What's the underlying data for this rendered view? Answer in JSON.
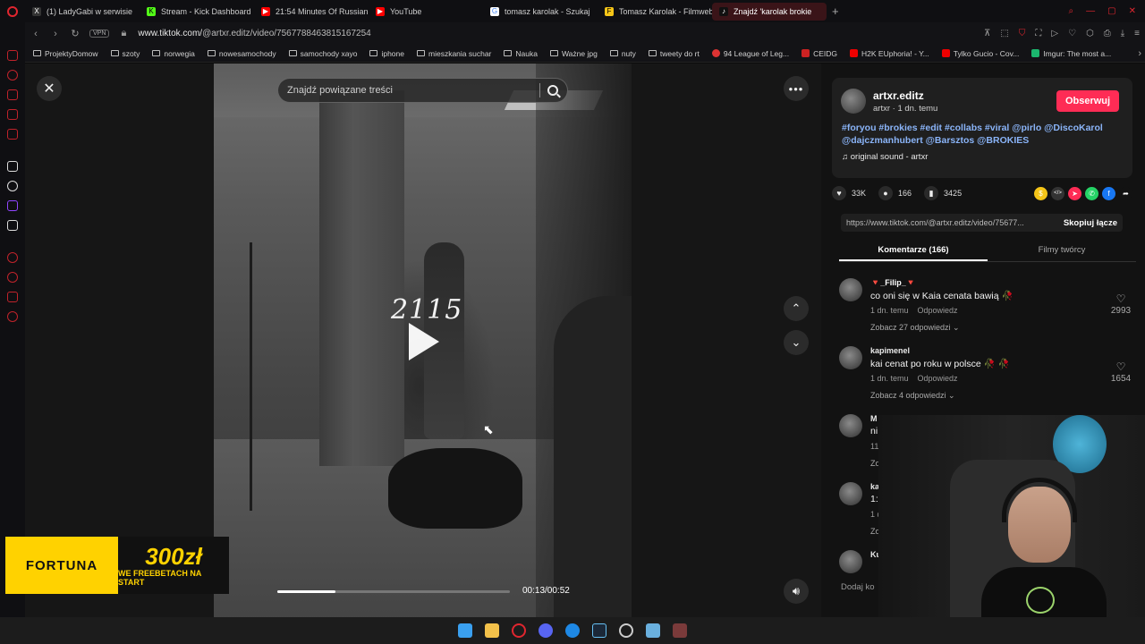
{
  "browser": {
    "tabs": [
      {
        "label": "(1) LadyGabi w serwisie",
        "fav_color": "#333",
        "fav_glyph": "X"
      },
      {
        "label": "Stream - Kick Dashboard",
        "fav_color": "#53fc18",
        "fav_glyph": "K"
      },
      {
        "label": "21:54 Minutes Of Russian",
        "fav_color": "#ff0000",
        "fav_glyph": "▶"
      },
      {
        "label": "YouTube",
        "fav_color": "#ff0000",
        "fav_glyph": "▶"
      },
      {
        "label": "tomasz karolak - Szukaj",
        "fav_color": "#4285f4",
        "fav_glyph": "G"
      },
      {
        "label": "Tomasz Karolak - Filmweb",
        "fav_color": "#f5c518",
        "fav_glyph": "F"
      },
      {
        "label": "Znajdź 'karolak brokie",
        "fav_color": "#111",
        "fav_glyph": "♪"
      }
    ],
    "new_tab": "+",
    "url_prefix": "www.tiktok.com/",
    "url_path": "@artxr.editz/video/7567788463815167254",
    "vpn_label": "VPN",
    "bookmarks": [
      {
        "label": "ProjektyDomow",
        "type": "folder"
      },
      {
        "label": "szoty",
        "type": "folder"
      },
      {
        "label": "norwegia",
        "type": "folder"
      },
      {
        "label": "nowesamochody",
        "type": "folder"
      },
      {
        "label": "samochody xayo",
        "type": "folder"
      },
      {
        "label": "iphone",
        "type": "folder"
      },
      {
        "label": "mieszkania suchar",
        "type": "folder"
      },
      {
        "label": "Nauka",
        "type": "folder"
      },
      {
        "label": "Ważne jpg",
        "type": "folder"
      },
      {
        "label": "nuty",
        "type": "folder"
      },
      {
        "label": "tweety do rt",
        "type": "folder"
      },
      {
        "label": "94 League of Leg...",
        "type": "site",
        "color": "#d33"
      },
      {
        "label": "CEIDG",
        "type": "site",
        "color": "#c22"
      },
      {
        "label": "H2K EUphoria! - Y...",
        "type": "site",
        "color": "#e00"
      },
      {
        "label": "Tylko Gucio - Cov...",
        "type": "site",
        "color": "#e00"
      },
      {
        "label": "Imgur: The most a...",
        "type": "site",
        "color": "#1bb76e"
      }
    ]
  },
  "video": {
    "search_placeholder": "Znajdź powiązane treści",
    "overlay_text": "2115",
    "time": "00:13/00:52",
    "progress": 0.25
  },
  "author": {
    "name": "artxr.editz",
    "sub": "artxr · 1 dn. temu",
    "follow_label": "Obserwuj",
    "description": "#foryou #brokies #edit #collabs #viral @pirlo @DiscoKarol @dajczmanhubert @Barsztos @BROKIES",
    "sound": "original sound - artxr"
  },
  "actions": {
    "likes": "33K",
    "comments": "166",
    "saves": "3425"
  },
  "share_icons": [
    {
      "name": "coin-icon",
      "color": "#f5c518",
      "glyph": "$"
    },
    {
      "name": "embed-icon",
      "color": "#333",
      "glyph": "</>"
    },
    {
      "name": "send-icon",
      "color": "#fe2c55",
      "glyph": "➤"
    },
    {
      "name": "whatsapp-icon",
      "color": "#25d366",
      "glyph": "✆"
    },
    {
      "name": "facebook-icon",
      "color": "#1877f2",
      "glyph": "f"
    },
    {
      "name": "share-arrow-icon",
      "color": "#121212",
      "glyph": "➦"
    }
  ],
  "link": {
    "url": "https://www.tiktok.com/@artxr.editz/video/75677...",
    "copy_label": "Skopiuj łącze"
  },
  "panel_tabs": {
    "comments": "Komentarze (166)",
    "creator_videos": "Filmy twórcy"
  },
  "comments": [
    {
      "user": "🔻_Filip_🔻",
      "text": "co oni się w Kaia cenata bawią 🥀",
      "time": "1 dn. temu",
      "reply": "Odpowiedz",
      "replies": "Zobacz 27 odpowiedzi ⌄",
      "likes": "2993"
    },
    {
      "user": "kapimenel",
      "text": "kai cenat po roku w polsce 🥀 🥀",
      "time": "1 dn. temu",
      "reply": "Odpowiedz",
      "replies": "Zobacz 4 odpowiedzi ⌄",
      "likes": "1654"
    },
    {
      "user": "M",
      "text": "ni",
      "time": "11",
      "reply": "",
      "replies": "Zo",
      "likes": ""
    },
    {
      "user": "ka",
      "text": "1:",
      "time": "1 d",
      "reply": "",
      "replies": "Zo",
      "likes": ""
    },
    {
      "user": "Ku",
      "text": "",
      "time": "",
      "reply": "",
      "replies": "",
      "likes": ""
    }
  ],
  "add_comment_placeholder": "Dodaj ko",
  "ad": {
    "brand": "FORTUNA",
    "amount": "300zł",
    "sub": "WE FREEBETACH NA START"
  }
}
